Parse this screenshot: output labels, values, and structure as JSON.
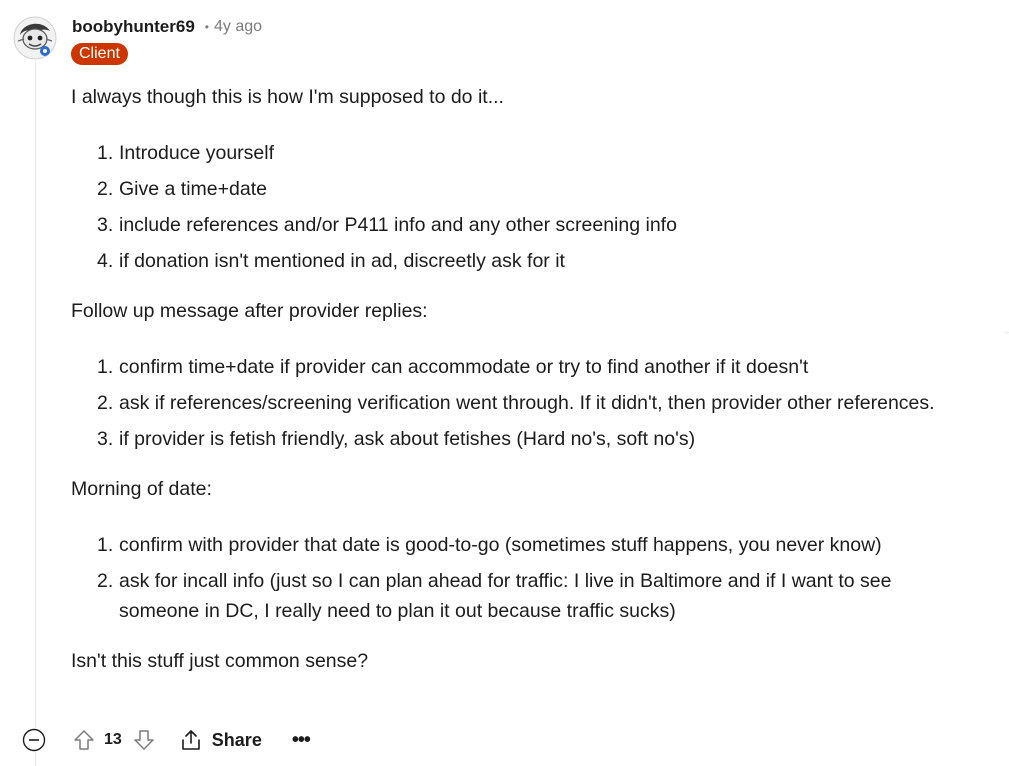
{
  "comment": {
    "author": "boobyhunter69",
    "separator": "•",
    "time_ago": "4y ago",
    "flair": "Client",
    "paragraph_1": "I always though this is how I'm supposed to do it...",
    "list_1": [
      {
        "num": "1.",
        "text": "Introduce yourself"
      },
      {
        "num": "2.",
        "text": "Give a time+date"
      },
      {
        "num": "3.",
        "text": "include references and/or P411 info and any other screening info"
      },
      {
        "num": "4.",
        "text": "if donation isn't mentioned in ad, discreetly ask for it"
      }
    ],
    "paragraph_2": "Follow up message after provider replies:",
    "list_2": [
      {
        "num": "1.",
        "text": "confirm time+date if provider can accommodate or try to find another if it doesn't"
      },
      {
        "num": "2.",
        "text": "ask if references/screening verification went through. If it didn't, then provider other references."
      },
      {
        "num": "3.",
        "text": "if provider is fetish friendly, ask about fetishes (Hard no's, soft no's)"
      }
    ],
    "paragraph_3": "Morning of date:",
    "list_3": [
      {
        "num": "1.",
        "text": "confirm with provider that date is good-to-go (sometimes stuff happens, you never know)"
      },
      {
        "num": "2.",
        "text": "ask for incall info (just so I can plan ahead for traffic: I live in Baltimore and if I want to see someone in DC, I really need to plan it out because traffic sucks)"
      }
    ],
    "paragraph_4": "Isn't this stuff just common sense?"
  },
  "actions": {
    "score": "13",
    "share_label": "Share",
    "more_label": "•••"
  },
  "icons": {
    "collapse": "minus-circle-icon",
    "upvote": "arrow-up-icon",
    "downvote": "arrow-down-icon",
    "share": "share-icon",
    "avatar": "avatar-image"
  },
  "colors": {
    "flair_bg": "#cc3600",
    "text": "#1c1c1c",
    "muted": "#7c7c7c"
  }
}
